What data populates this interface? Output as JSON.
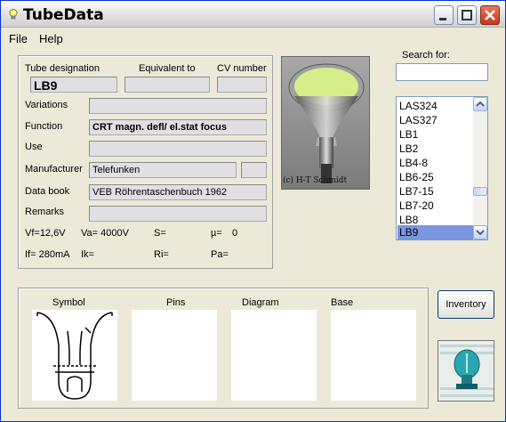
{
  "window": {
    "title": "TubeData"
  },
  "menu": {
    "file": "File",
    "help": "Help"
  },
  "labels": {
    "designation": "Tube designation",
    "equivalent": "Equivalent to",
    "cv": "CV number",
    "variations": "Variations",
    "function": "Function",
    "use": "Use",
    "manufacturer": "Manufacturer",
    "databook": "Data book",
    "remarks": "Remarks",
    "search": "Search for:",
    "symbol": "Symbol",
    "pins": "Pins",
    "diagram": "Diagram",
    "base": "Base"
  },
  "fields": {
    "designation": "LB9",
    "equivalent": "",
    "cv": "",
    "variations": "",
    "function": "CRT magn. defl/ el.stat focus",
    "use": "",
    "manufacturer": "Telefunken",
    "manufacturer_code": "",
    "databook": "VEB Röhrentaschenbuch 1962",
    "remarks": ""
  },
  "params": {
    "vf": "Vf=12,6V",
    "va": "Va= 4000V",
    "s": "S=",
    "mu": "µ=",
    "mu_val": "0",
    "if": "If= 280mA",
    "ik": "Ik=",
    "ri": "Ri=",
    "pa": "Pa="
  },
  "photo": {
    "credit": "(c) H-T Schmidt"
  },
  "search": {
    "value": ""
  },
  "list": {
    "items": [
      "LAS324",
      "LAS327",
      "LB1",
      "LB2",
      "LB4-8",
      "LB6-25",
      "LB7-15",
      "LB7-20",
      "LB8",
      "LB9"
    ],
    "selected": "LB9"
  },
  "buttons": {
    "inventory": "Inventory"
  },
  "colors": {
    "selection": "#7a96df",
    "titlebar_close": "#c2381a"
  }
}
